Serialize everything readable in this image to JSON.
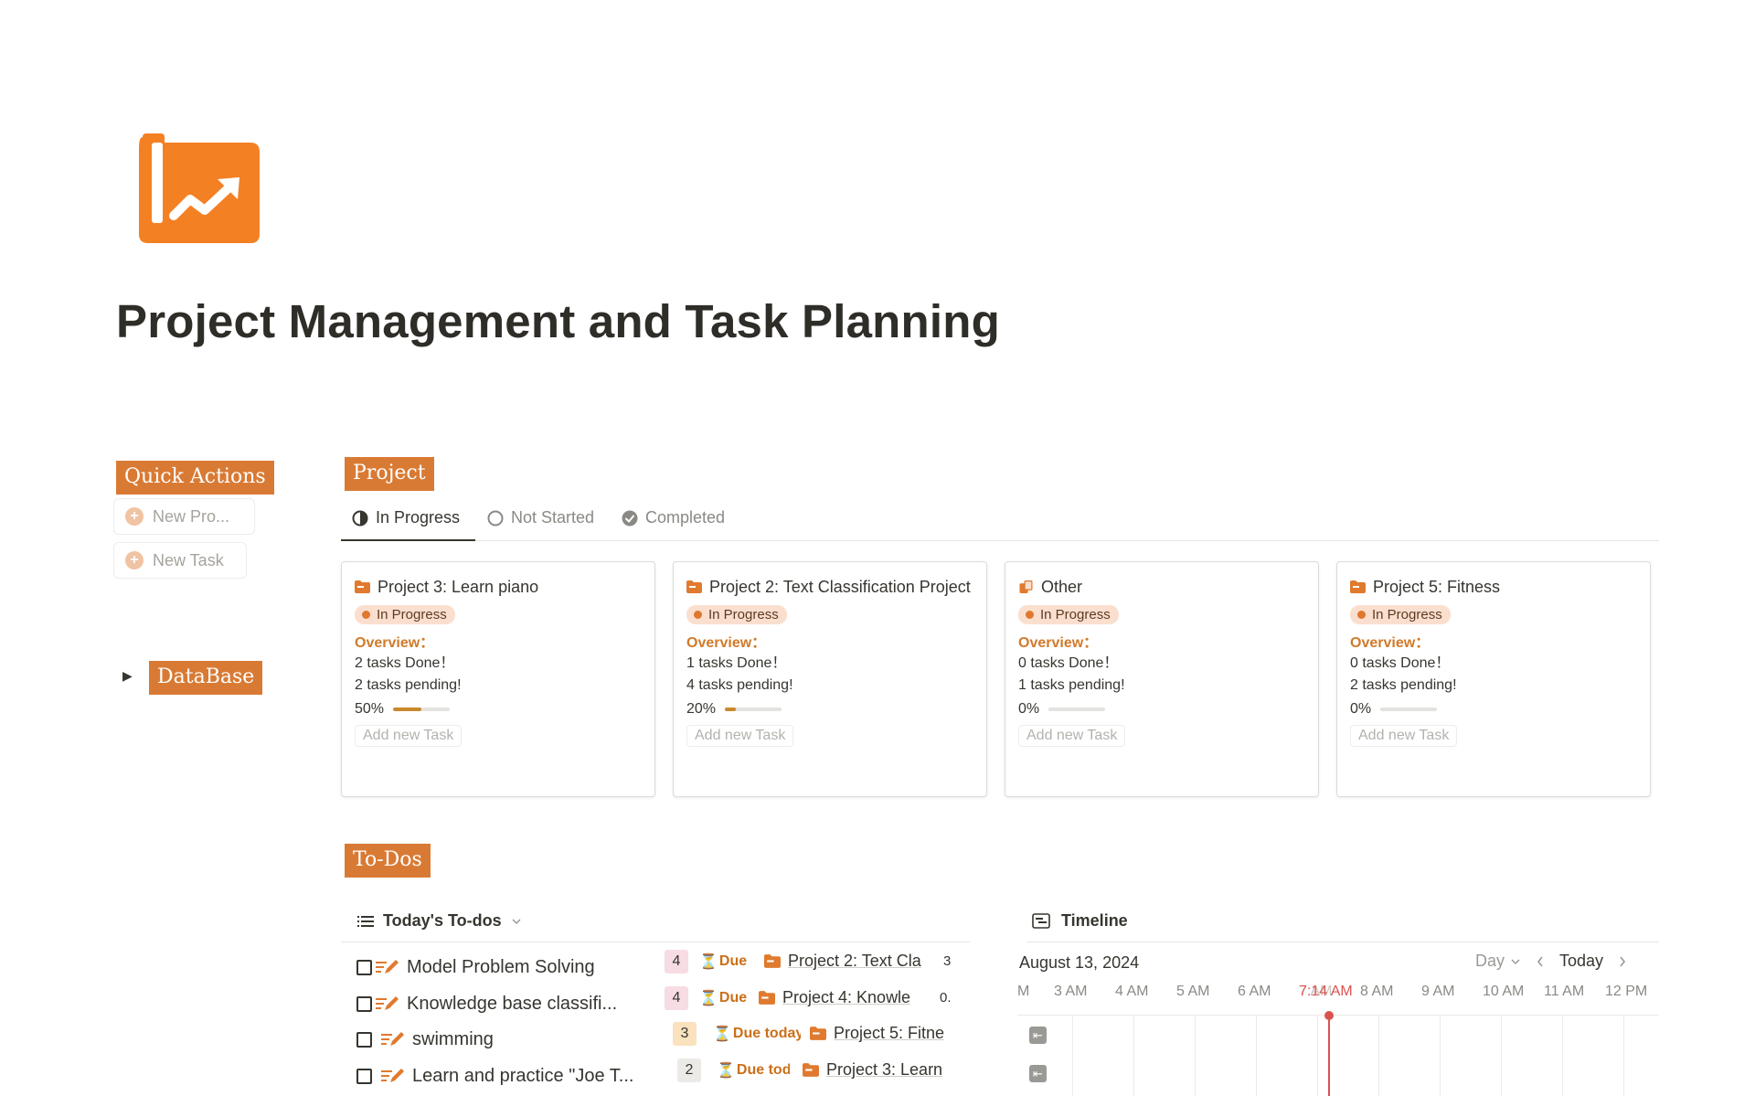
{
  "page": {
    "title": "Project Management and Task Planning",
    "icon": "chart-folder-icon",
    "accent": "#f48024"
  },
  "quick_actions": {
    "heading": "Quick Actions",
    "buttons": [
      {
        "label": "New Pro..."
      },
      {
        "label": "New Task"
      }
    ]
  },
  "database": {
    "toggle": "▶",
    "label": "DataBase"
  },
  "project_section": {
    "heading": "Project",
    "tabs": [
      {
        "label": "In Progress",
        "icon": "half-circle-icon",
        "active": true
      },
      {
        "label": "Not Started",
        "icon": "empty-circle-icon",
        "active": false
      },
      {
        "label": "Completed",
        "icon": "check-circle-icon",
        "active": false
      }
    ],
    "cards": [
      {
        "title": "Project 3: Learn piano",
        "status": "In Progress",
        "overview": "Overview：",
        "done": "2 tasks Done！",
        "pending": "2 tasks pending!",
        "progress_label": "50%",
        "progress": 0.5,
        "add_label": "Add new Task"
      },
      {
        "title": "Project 2: Text Classification Project",
        "status": "In Progress",
        "overview": "Overview：",
        "done": "1 tasks Done！",
        "pending": "4 tasks pending!",
        "progress_label": "20%",
        "progress": 0.2,
        "add_label": "Add new Task"
      },
      {
        "title": "Other",
        "status": "In Progress",
        "overview": "Overview：",
        "done": "0 tasks Done！",
        "pending": "1 tasks pending!",
        "progress_label": "0%",
        "progress": 0,
        "add_label": "Add new Task"
      },
      {
        "title": "Project 5: Fitness",
        "status": "In Progress",
        "overview": "Overview：",
        "done": "0 tasks Done！",
        "pending": "2 tasks pending!",
        "progress_label": "0%",
        "progress": 0,
        "add_label": "Add new Task"
      }
    ]
  },
  "todos": {
    "heading": "To-Dos",
    "view_label": "Today's To-dos",
    "rows": [
      {
        "name": "Model Problem Solving",
        "priority": "4",
        "due": "Due t",
        "project": "Project 2: Text Cla",
        "tail": "3"
      },
      {
        "name": "Knowledge base classifi...",
        "priority": "4",
        "due": "Due ",
        "project": "Project 4: Knowle",
        "tail": "0."
      },
      {
        "name": "swimming",
        "priority": "3",
        "due": "Due today",
        "project": "Project 5: Fitne",
        "tail": ""
      },
      {
        "name": "Learn and practice \"Joe T...",
        "priority": "2",
        "due": "Due toda",
        "project": "Project 3: Learn",
        "tail": ""
      }
    ]
  },
  "timeline": {
    "label": "Timeline",
    "date": "August 13, 2024",
    "scale": "Day",
    "today_label": "Today",
    "now_label": "7:14 AM",
    "hours": [
      "M",
      "3 AM",
      "4 AM",
      "5 AM",
      "6 AM",
      "7 AM",
      "8 AM",
      "9 AM",
      "10 AM",
      "11 AM",
      "12 PM"
    ]
  }
}
